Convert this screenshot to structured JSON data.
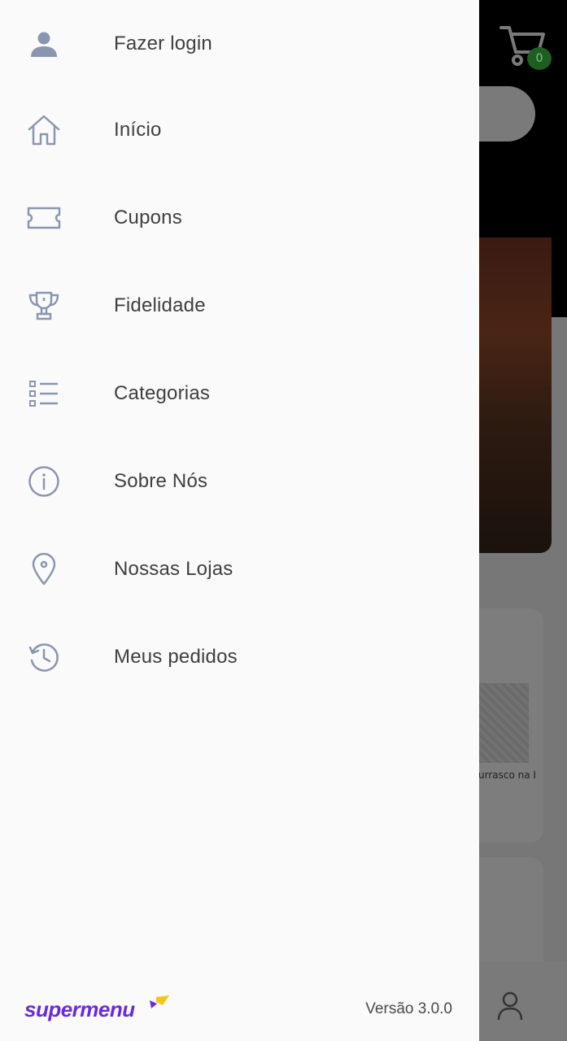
{
  "cart": {
    "count": "0"
  },
  "background": {
    "card_text": "urrasco na brasa"
  },
  "menu": [
    {
      "label": "Fazer login",
      "icon": "user-icon"
    },
    {
      "label": "Início",
      "icon": "home-icon"
    },
    {
      "label": "Cupons",
      "icon": "ticket-icon"
    },
    {
      "label": "Fidelidade",
      "icon": "trophy-icon"
    },
    {
      "label": "Categorias",
      "icon": "list-icon"
    },
    {
      "label": "Sobre Nós",
      "icon": "info-icon"
    },
    {
      "label": "Nossas Lojas",
      "icon": "location-pin-icon"
    },
    {
      "label": "Meus pedidos",
      "icon": "history-icon"
    }
  ],
  "footer": {
    "brand": "supermenu",
    "version": "Versão 3.0.0"
  },
  "colors": {
    "icon": "#8a96b0",
    "text": "#3f3f3f",
    "brand": "#6a2bd6",
    "brand_accent": "#f5c518",
    "badge": "#1e5e22"
  }
}
